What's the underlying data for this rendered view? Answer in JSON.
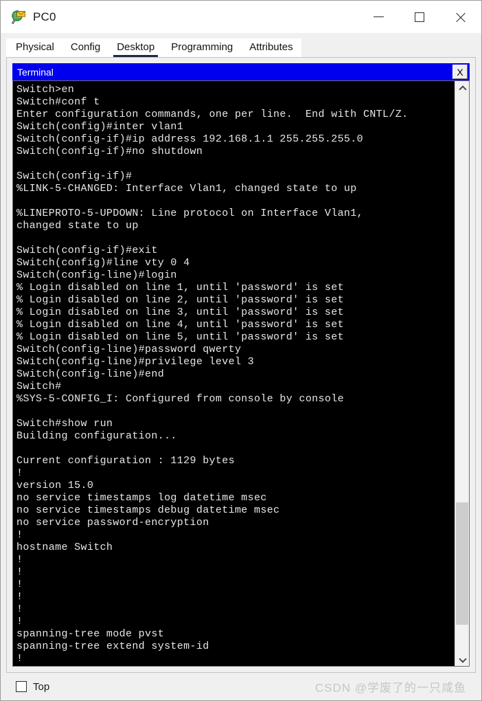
{
  "window": {
    "title": "PC0",
    "icon": "packet-tracer-pc-icon",
    "minimize_label": "—",
    "maximize_label": "□",
    "close_label": "✕"
  },
  "tabs": [
    {
      "label": "Physical",
      "active": false
    },
    {
      "label": "Config",
      "active": false
    },
    {
      "label": "Desktop",
      "active": true
    },
    {
      "label": "Programming",
      "active": false
    },
    {
      "label": "Attributes",
      "active": false
    }
  ],
  "terminal": {
    "title": "Terminal",
    "close_label": "X",
    "background": "#000000",
    "foreground": "#e8e8e8",
    "titlebar_color": "#0000ee",
    "content": "Switch>en\nSwitch#conf t\nEnter configuration commands, one per line.  End with CNTL/Z.\nSwitch(config)#inter vlan1\nSwitch(config-if)#ip address 192.168.1.1 255.255.255.0\nSwitch(config-if)#no shutdown\n\nSwitch(config-if)#\n%LINK-5-CHANGED: Interface Vlan1, changed state to up\n\n%LINEPROTO-5-UPDOWN: Line protocol on Interface Vlan1,\nchanged state to up\n\nSwitch(config-if)#exit\nSwitch(config)#line vty 0 4\nSwitch(config-line)#login\n% Login disabled on line 1, until 'password' is set\n% Login disabled on line 2, until 'password' is set\n% Login disabled on line 3, until 'password' is set\n% Login disabled on line 4, until 'password' is set\n% Login disabled on line 5, until 'password' is set\nSwitch(config-line)#password qwerty\nSwitch(config-line)#privilege level 3\nSwitch(config-line)#end\nSwitch#\n%SYS-5-CONFIG_I: Configured from console by console\n\nSwitch#show run\nBuilding configuration...\n\nCurrent configuration : 1129 bytes\n!\nversion 15.0\nno service timestamps log datetime msec\nno service timestamps debug datetime msec\nno service password-encryption\n!\nhostname Switch\n!\n!\n!\n!\n!\n!\nspanning-tree mode pvst\nspanning-tree extend system-id\n!"
  },
  "scrollbar": {
    "up_arrow": "chevron-up-icon",
    "down_arrow": "chevron-down-icon",
    "thumb_top_pct": 72,
    "thumb_height_pct": 21
  },
  "footer": {
    "top_checkbox_label": "Top",
    "top_checkbox_checked": false,
    "watermark": "CSDN @学废了的一只咸鱼"
  }
}
